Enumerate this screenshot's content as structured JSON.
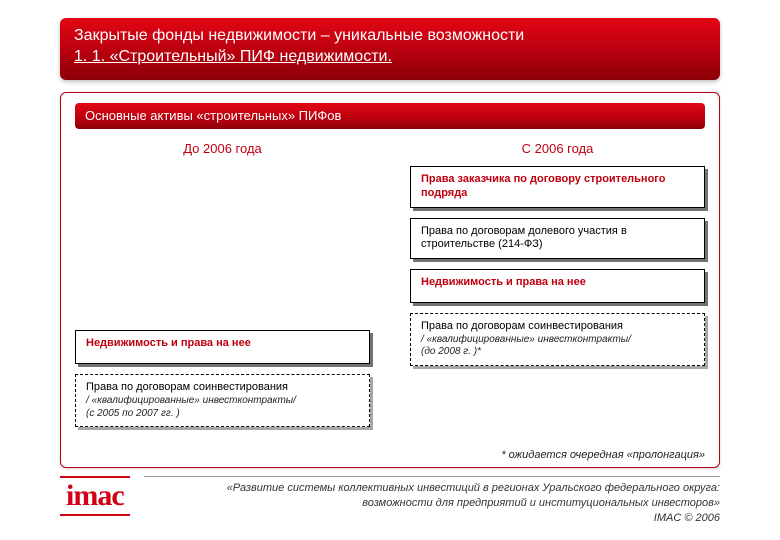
{
  "header": {
    "title_line1": "Закрытые фонды недвижимости – уникальные возможности",
    "title_line2": "1. 1. «Строительный» ПИФ недвижимости."
  },
  "panel": {
    "band": "Основные активы «строительных» ПИФов",
    "col_left_head": "До 2006 года",
    "col_right_head": "С 2006 года",
    "left": {
      "c1": "Недвижимость и права на нее",
      "c2_main": "Права по договорам соинвестирования",
      "c2_sub1": "/ «квалифицированные» инвестконтракты/",
      "c2_sub2": "(с 2005 по 2007 гг. )"
    },
    "right": {
      "c1": "Права заказчика по договору строительного подряда",
      "c2": "Права по договорам долевого участия в строительстве (214-ФЗ)",
      "c3": "Недвижимость и права на нее",
      "c4_main": "Права по договорам соинвестирования",
      "c4_sub1": "/ «квалифицированные» инвестконтракты/",
      "c4_sub2": "(до 2008 г. )*"
    },
    "footnote": "* ожидается очередная «пролонгация»"
  },
  "footer": {
    "logo": "imac",
    "text_line1": "«Развитие системы коллективных инвестиций в регионах Уральского федерального округа:",
    "text_line2": "возможности для предприятий и институциональных инвесторов»",
    "text_line3": "IMAC © 2006"
  }
}
